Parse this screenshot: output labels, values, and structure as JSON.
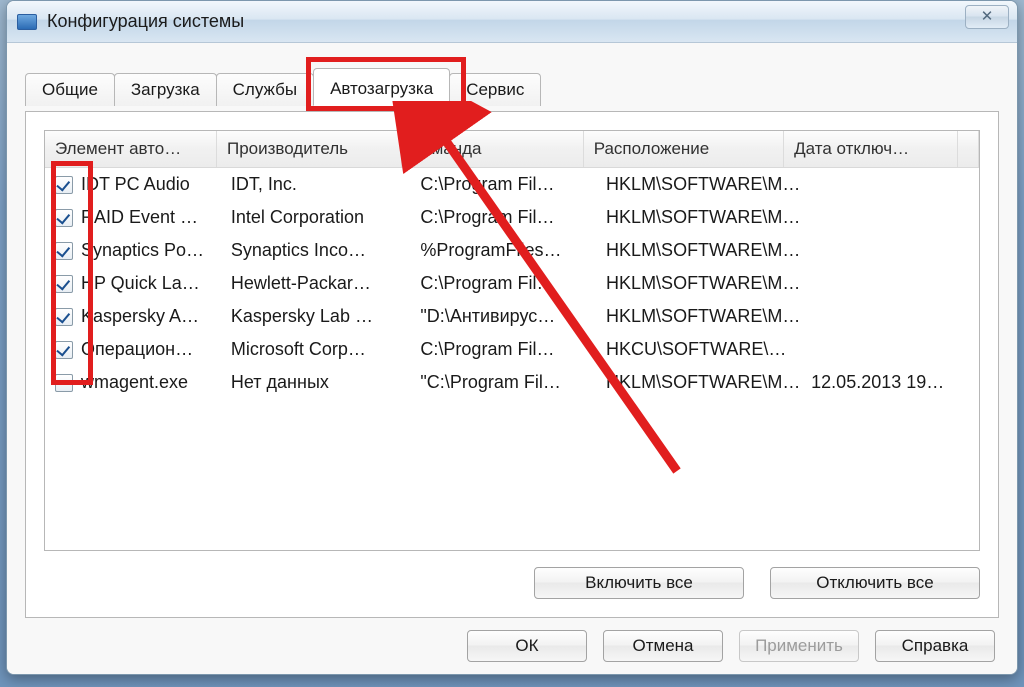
{
  "window": {
    "title": "Конфигурация системы",
    "close_label": "✕"
  },
  "tabs": [
    {
      "label": "Общие"
    },
    {
      "label": "Загрузка"
    },
    {
      "label": "Службы"
    },
    {
      "label": "Автозагрузка"
    },
    {
      "label": "Сервис"
    }
  ],
  "active_tab_index": 3,
  "columns": [
    "Элемент авто…",
    "Производитель",
    "Команда",
    "Расположение",
    "Дата отключ…",
    ""
  ],
  "rows": [
    {
      "checked": true,
      "item": "IDT PC Audio",
      "vendor": "IDT, Inc.",
      "cmd": "C:\\Program Fil…",
      "loc": "HKLM\\SOFTWARE\\M…",
      "date": ""
    },
    {
      "checked": true,
      "item": "RAID Event …",
      "vendor": "Intel Corporation",
      "cmd": "C:\\Program Fil…",
      "loc": "HKLM\\SOFTWARE\\M…",
      "date": ""
    },
    {
      "checked": true,
      "item": "Synaptics Po…",
      "vendor": "Synaptics Inco…",
      "cmd": "%ProgramFiles…",
      "loc": "HKLM\\SOFTWARE\\M…",
      "date": ""
    },
    {
      "checked": true,
      "item": "HP Quick La…",
      "vendor": "Hewlett-Packar…",
      "cmd": "C:\\Program Fil…",
      "loc": "HKLM\\SOFTWARE\\M…",
      "date": ""
    },
    {
      "checked": true,
      "item": "Kaspersky A…",
      "vendor": "Kaspersky Lab …",
      "cmd": "\"D:\\Антивирус…",
      "loc": "HKLM\\SOFTWARE\\M…",
      "date": ""
    },
    {
      "checked": true,
      "item": "Операцион…",
      "vendor": "Microsoft Corp…",
      "cmd": "C:\\Program Fil…",
      "loc": "HKCU\\SOFTWARE\\…",
      "date": ""
    },
    {
      "checked": false,
      "item": "wmagent.exe",
      "vendor": "Нет данных",
      "cmd": "\"C:\\Program Fil…",
      "loc": "HKLM\\SOFTWARE\\M…",
      "date": "12.05.2013 19…"
    }
  ],
  "panel_buttons": {
    "enable_all": "Включить все",
    "disable_all": "Отключить все"
  },
  "dialog_buttons": {
    "ok": "ОК",
    "cancel": "Отмена",
    "apply": "Применить",
    "help": "Справка"
  }
}
